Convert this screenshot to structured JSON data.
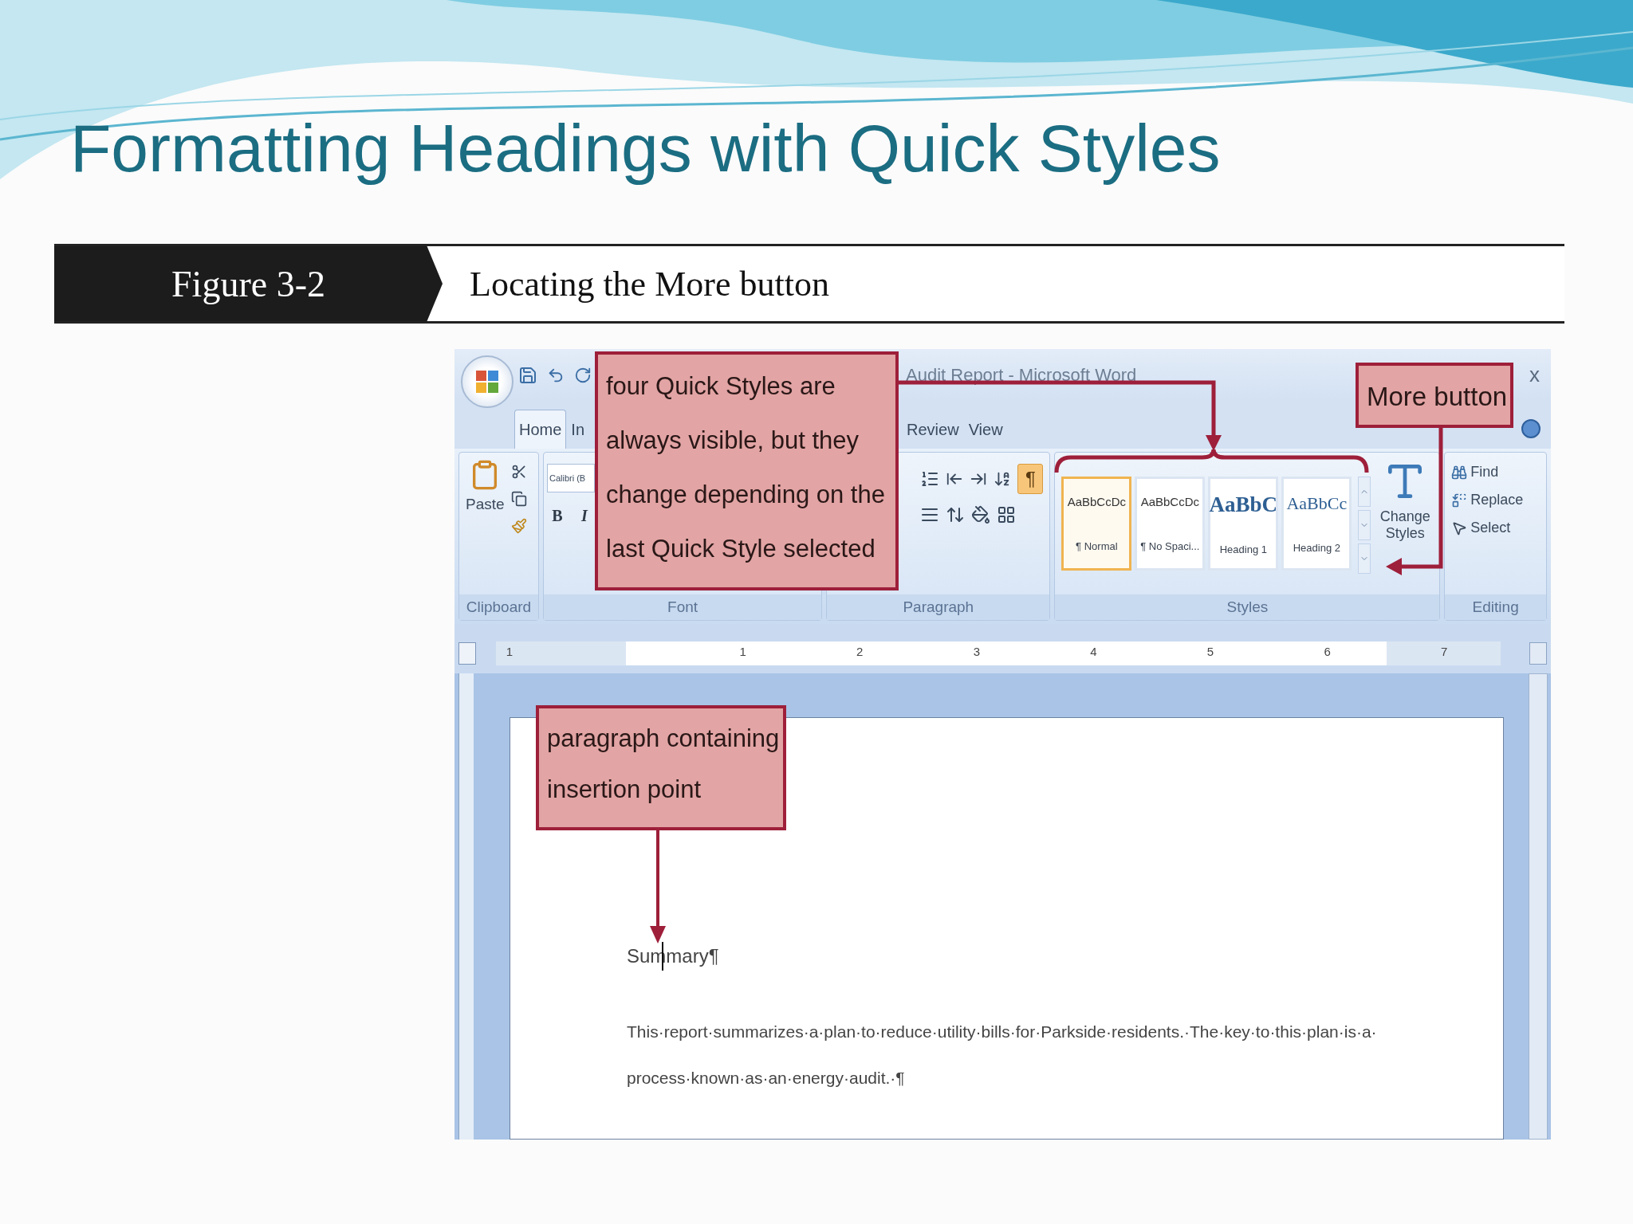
{
  "slide": {
    "title": "Formatting Headings with Quick Styles"
  },
  "figure": {
    "number": "Figure 3-2",
    "caption": "Locating the More button"
  },
  "word": {
    "title_bar": {
      "title": "Audit Report - Microsoft Word",
      "close": "x"
    },
    "tabs": [
      {
        "label": "Home",
        "selected": true
      },
      {
        "label": "In",
        "selected": false
      },
      {
        "label": "Review",
        "selected": false
      },
      {
        "label": "View",
        "selected": false
      }
    ],
    "clipboard": {
      "paste": "Paste",
      "label": "Clipboard"
    },
    "font": {
      "font_name": "Calibri (B",
      "bold": "B",
      "italic": "I",
      "label": "Font"
    },
    "paragraph": {
      "show_marks": {
        "label": "¶",
        "on": true
      },
      "label": "Paragraph"
    },
    "styles": {
      "items": [
        {
          "kind": "normal",
          "sample": "AaBbCcDc",
          "name": "¶ Normal",
          "selected": true
        },
        {
          "kind": "normal",
          "sample": "AaBbCcDc",
          "name": "¶ No Spaci...",
          "selected": false
        },
        {
          "kind": "heading1",
          "sample": "AaBbC",
          "name": "Heading 1",
          "selected": false
        },
        {
          "kind": "heading2",
          "sample": "AaBbCc",
          "name": "Heading 2",
          "selected": false
        }
      ],
      "change_styles": "Change Styles",
      "label": "Styles"
    },
    "editing": {
      "find": "Find",
      "replace": "Replace",
      "select": "Select",
      "label": "Editing"
    },
    "ruler": [
      "1",
      "1",
      "2",
      "3",
      "4",
      "5",
      "6",
      "7"
    ],
    "document": {
      "heading": "Summary¶",
      "body_lines": [
        "This·report·summarizes·a·plan·to·reduce·utility·bills·for·Parkside·residents.·The·key·to·this·plan·is·a·",
        "process·known·as·an·energy·audit.·¶"
      ]
    }
  },
  "callouts": [
    {
      "kind": "styles",
      "lines": [
        "four Quick Styles are",
        "always visible, but they",
        "change depending on the",
        "last Quick Style selected"
      ]
    },
    {
      "kind": "more",
      "lines": [
        "More button"
      ]
    },
    {
      "kind": "paragraph",
      "lines": [
        "paragraph containing",
        "insertion point"
      ]
    }
  ]
}
